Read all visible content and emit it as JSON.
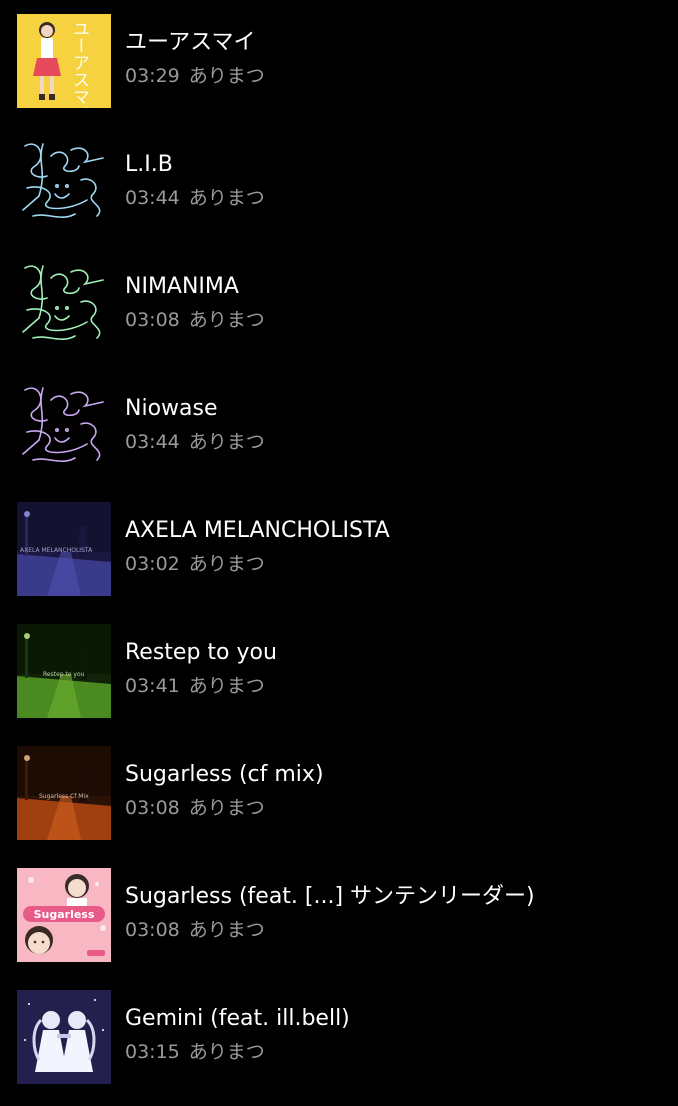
{
  "tracks": [
    {
      "title": "ユーアスマイ",
      "duration": "03:29",
      "artist": "ありまつ",
      "art_icon": "ユーアスマイ",
      "art_text": "ユーアスマイ"
    },
    {
      "title": "L.I.B",
      "duration": "03:44",
      "artist": "ありまつ",
      "art_icon": "scribble-signature-icon",
      "stroke_color": "#9fd8f2"
    },
    {
      "title": "NIMANIMA",
      "duration": "03:08",
      "artist": "ありまつ",
      "art_icon": "scribble-signature-icon",
      "stroke_color": "#9ff0b8"
    },
    {
      "title": "Niowase",
      "duration": "03:44",
      "artist": "ありまつ",
      "art_icon": "scribble-signature-icon",
      "stroke_color": "#c8a8f0"
    },
    {
      "title": "AXELA MELANCHOLISTA",
      "duration": "03:02",
      "artist": "ありまつ",
      "art_icon": "night-street-photo",
      "art_text": "AXELA MELANCHOLISTA"
    },
    {
      "title": "Restep to you",
      "duration": "03:41",
      "artist": "ありまつ",
      "art_icon": "night-street-photo",
      "art_text": "Restep to you"
    },
    {
      "title": "Sugarless (cf mix)",
      "duration": "03:08",
      "artist": "ありまつ",
      "art_icon": "night-street-photo",
      "art_text": "Sugarless Cf Mix"
    },
    {
      "title": "Sugarless (feat. [...] サンテンリーダー)",
      "duration": "03:08",
      "artist": "ありまつ",
      "art_icon": "pink-illustration",
      "art_text": "Sugarless"
    },
    {
      "title": "Gemini (feat. ill.bell)",
      "duration": "03:15",
      "artist": "ありまつ",
      "art_icon": "twin-figures-illustration"
    }
  ]
}
